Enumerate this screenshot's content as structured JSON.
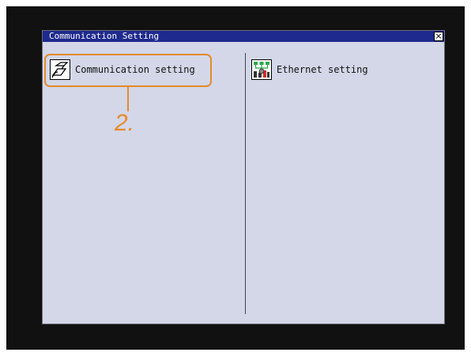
{
  "window": {
    "title": "Communication Setting",
    "close_symbol": "×",
    "background": "#d3d7e8",
    "titlebar_color": "#1f2a8e"
  },
  "menu": {
    "items": [
      {
        "label": "Communication setting",
        "icon": "communication-setting-icon"
      },
      {
        "label": "Ethernet setting",
        "icon": "ethernet-setting-icon"
      }
    ]
  },
  "annotation": {
    "step_label": "2.",
    "color": "#e58a2a"
  }
}
